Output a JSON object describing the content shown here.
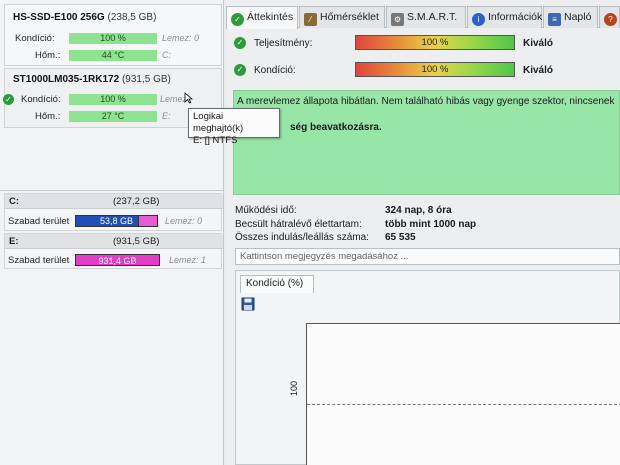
{
  "left": {
    "disks": [
      {
        "name": "HS-SSD-E100 256G",
        "size": "(238,5 GB)",
        "condition_label": "Kondíció:",
        "condition_value": "100 %",
        "temp_label": "Hőm.:",
        "temp_value": "44 °C",
        "side1": "Lemez: 0",
        "side2": "C:"
      },
      {
        "name": "ST1000LM035-1RK172",
        "size": "(931,5 GB)",
        "condition_label": "Kondíció:",
        "condition_value": "100 %",
        "temp_label": "Hőm.:",
        "temp_value": "27 °C",
        "side1": "Lemez",
        "side2": "E:"
      }
    ],
    "volumes": [
      {
        "letter": "C:",
        "size": "(237,2 GB)",
        "free_label": "Szabad terület",
        "free_value": "53,8 GB",
        "disk": "Lemez: 0",
        "free_fraction": 0.227
      },
      {
        "letter": "E:",
        "size": "(931,5 GB)",
        "free_label": "Szabad terület",
        "free_value": "931,4 GB",
        "disk": "Lemez: 1",
        "free_fraction": 1.0
      }
    ]
  },
  "tooltip": {
    "line1": "Logikai meghajtó(k)",
    "line2": "E: [] NTFS"
  },
  "tabs": [
    "Áttekintés",
    "Hőmérséklet",
    "S.M.A.R.T.",
    "Információk",
    "Napló"
  ],
  "status": {
    "performance_label": "Teljesítmény:",
    "performance_value": "100 %",
    "performance_rating": "Kiváló",
    "condition_label": "Kondíció:",
    "condition_value": "100 %",
    "condition_rating": "Kiváló"
  },
  "message": {
    "line1": "A merevlemez állapota hibátlan. Nem található hibás vagy gyenge szektor, nincsenek",
    "line2": "ség beavatkozásra."
  },
  "info": [
    {
      "label": "Működési idő:",
      "value": "324 nap, 8 óra"
    },
    {
      "label": "Becsült hátralévő élettartam:",
      "value": "több mint 1000 nap"
    },
    {
      "label": "Összes indulás/leállás száma:",
      "value": "65 535"
    }
  ],
  "note_placeholder": "Kattintson megjegyzés megadásához ...",
  "chart_tab": "Kondíció  (%)",
  "chart_data": {
    "type": "line",
    "ylabel": "",
    "y_ticks": [
      "100"
    ],
    "series": []
  },
  "colors": {
    "ok_green": "#2e9a3a",
    "free_blue": "#1f4fb7",
    "free_pink": "#e13ec7",
    "message_bg": "#98e5a8"
  }
}
